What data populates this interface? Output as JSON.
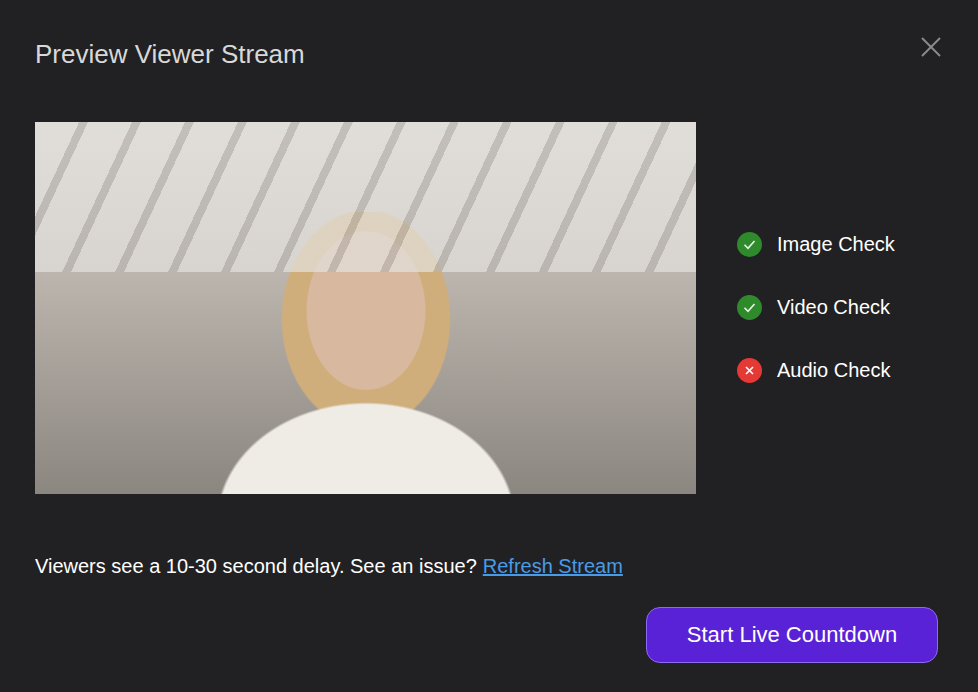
{
  "dialog": {
    "title": "Preview Viewer Stream"
  },
  "preview": {
    "kind": "video-frame"
  },
  "checks": [
    {
      "label": "Image Check",
      "passed": true
    },
    {
      "label": "Video Check",
      "passed": true
    },
    {
      "label": "Audio Check",
      "passed": false
    }
  ],
  "footer": {
    "note": "Viewers see a 10-30 second delay. See an issue?",
    "link": "Refresh Stream"
  },
  "buttons": [
    "Start Live Countdown"
  ]
}
